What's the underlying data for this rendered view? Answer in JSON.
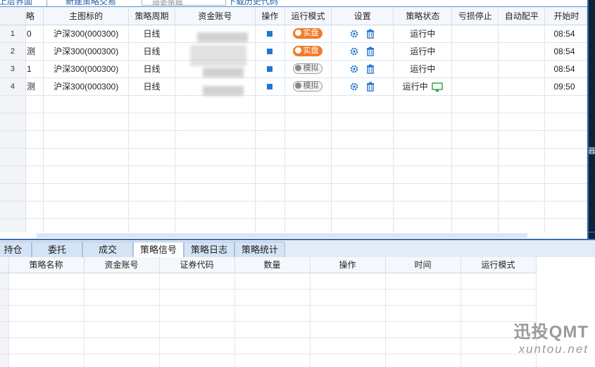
{
  "toolbar": {
    "link_left": "上层界面",
    "link_new": "新建策略交易",
    "search_placeholder": "搜索策略",
    "link_right": "下载历史代码"
  },
  "grid": {
    "columns": [
      "",
      "略",
      "主图标的",
      "策略周期",
      "资金账号",
      "操作",
      "运行模式",
      "设置",
      "策略状态",
      "亏损停止",
      "自动配平",
      "开始时"
    ],
    "rows": [
      {
        "num": "1",
        "name": "0",
        "symbol": "沪深300(000300)",
        "period": "日线",
        "account": "",
        "mode": "实盘",
        "mode_type": "live",
        "status": "运行中",
        "time": "08:54"
      },
      {
        "num": "2",
        "name": "测",
        "symbol": "沪深300(000300)",
        "period": "日线",
        "account": "",
        "mode": "实盘",
        "mode_type": "live",
        "status": "运行中",
        "time": "08:54"
      },
      {
        "num": "3",
        "name": "1",
        "symbol": "沪深300(000300)",
        "period": "日线",
        "account": "",
        "mode": "模拟",
        "mode_type": "sim",
        "status": "运行中",
        "time": "08:54"
      },
      {
        "num": "4",
        "name": "测",
        "symbol": "沪深300(000300)",
        "period": "日线",
        "account": "",
        "mode": "模拟",
        "mode_type": "sim",
        "status": "运行中",
        "time": "09:50"
      }
    ],
    "empty_rows": 8,
    "icons": {
      "stop": "stop-square-icon",
      "settings": "gear-icon",
      "delete": "trash-icon",
      "monitor": "monitor-icon"
    },
    "colors": {
      "live": "#ef7d2a",
      "status": "#2c9f3a",
      "accent": "#1e78d2"
    }
  },
  "right_strip": {
    "label": "暮"
  },
  "tabs": [
    {
      "label": "持仓",
      "active": false
    },
    {
      "label": "委托",
      "active": false
    },
    {
      "label": "成交",
      "active": false
    },
    {
      "label": "策略信号",
      "active": true
    },
    {
      "label": "策略日志",
      "active": false
    },
    {
      "label": "策略统计",
      "active": false
    }
  ],
  "bottom_grid": {
    "columns": [
      "",
      "策略名称",
      "资金账号",
      "证券代码",
      "数量",
      "操作",
      "时间",
      "运行模式"
    ],
    "empty_rows": 6
  },
  "watermark": {
    "brand": "迅投QMT",
    "url": "xuntou.net"
  }
}
